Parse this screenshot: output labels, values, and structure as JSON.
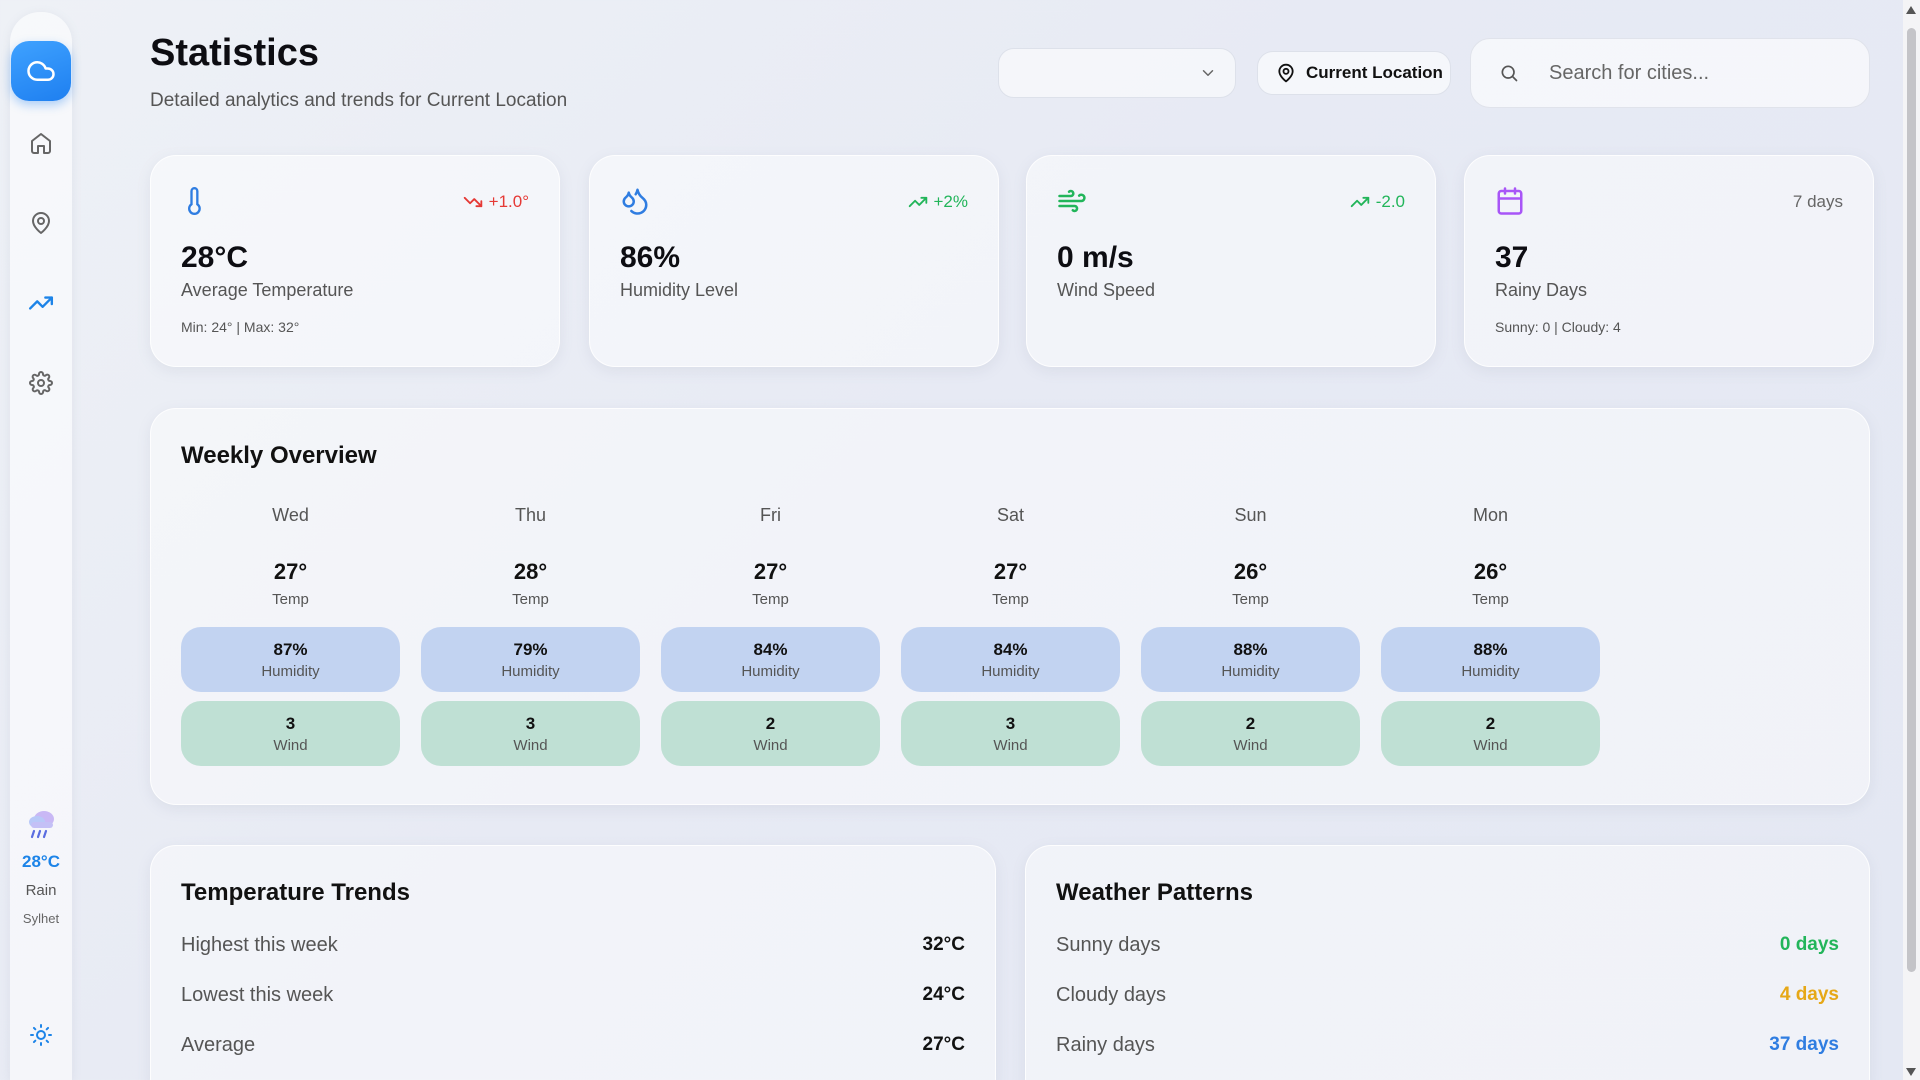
{
  "sidebar": {
    "logo_icon": "cloud-icon",
    "nav": [
      {
        "icon": "home-icon"
      },
      {
        "icon": "map-pin-icon"
      },
      {
        "icon": "trending-up-icon"
      },
      {
        "icon": "settings-icon"
      }
    ],
    "weather": {
      "icon": "rain-cloud-icon",
      "temp": "28°C",
      "condition": "Rain",
      "city": "Sylhet"
    },
    "theme_icon": "sun-icon"
  },
  "header": {
    "title": "Statistics",
    "subtitle": "Detailed analytics and trends for Current Location",
    "select_value": "",
    "location_button": "Current Location",
    "search_placeholder": "Search for cities..."
  },
  "cards": [
    {
      "icon": "thermometer-icon",
      "trend": "+1.0°",
      "trend_color": "#e53935",
      "trend_dir": "down",
      "value": "28°C",
      "label": "Average Temperature",
      "sub": "Min: 24° | Max: 32°"
    },
    {
      "icon": "droplets-icon",
      "trend": "+2%",
      "trend_color": "#22b55a",
      "trend_dir": "up",
      "value": "86%",
      "label": "Humidity Level",
      "sub": ""
    },
    {
      "icon": "wind-icon",
      "trend": "-2.0",
      "trend_color": "#22b55a",
      "trend_dir": "up",
      "value": "0 m/s",
      "label": "Wind Speed",
      "sub": ""
    },
    {
      "icon": "calendar-icon",
      "trend": "7 days",
      "trend_color": "#666666",
      "trend_dir": "none",
      "value": "37",
      "label": "Rainy Days",
      "sub": "Sunny: 0 | Cloudy: 4"
    }
  ],
  "weekly": {
    "title": "Weekly Overview",
    "temp_label": "Temp",
    "humidity_label": "Humidity",
    "wind_label": "Wind",
    "days": [
      {
        "day": "Wed",
        "temp": "27°",
        "humidity": "87%",
        "wind": "3"
      },
      {
        "day": "Thu",
        "temp": "28°",
        "humidity": "79%",
        "wind": "3"
      },
      {
        "day": "Fri",
        "temp": "27°",
        "humidity": "84%",
        "wind": "2"
      },
      {
        "day": "Sat",
        "temp": "27°",
        "humidity": "84%",
        "wind": "3"
      },
      {
        "day": "Sun",
        "temp": "26°",
        "humidity": "88%",
        "wind": "2"
      },
      {
        "day": "Mon",
        "temp": "26°",
        "humidity": "88%",
        "wind": "2"
      }
    ]
  },
  "trends": {
    "title": "Temperature Trends",
    "rows": [
      {
        "label": "Highest this week",
        "value": "32°C"
      },
      {
        "label": "Lowest this week",
        "value": "24°C"
      },
      {
        "label": "Average",
        "value": "27°C"
      }
    ]
  },
  "patterns": {
    "title": "Weather Patterns",
    "rows": [
      {
        "label": "Sunny days",
        "value": "0 days",
        "color": "#22b55a"
      },
      {
        "label": "Cloudy days",
        "value": "4 days",
        "color": "#e6a817"
      },
      {
        "label": "Rainy days",
        "value": "37 days",
        "color": "#2f7de1"
      }
    ]
  }
}
